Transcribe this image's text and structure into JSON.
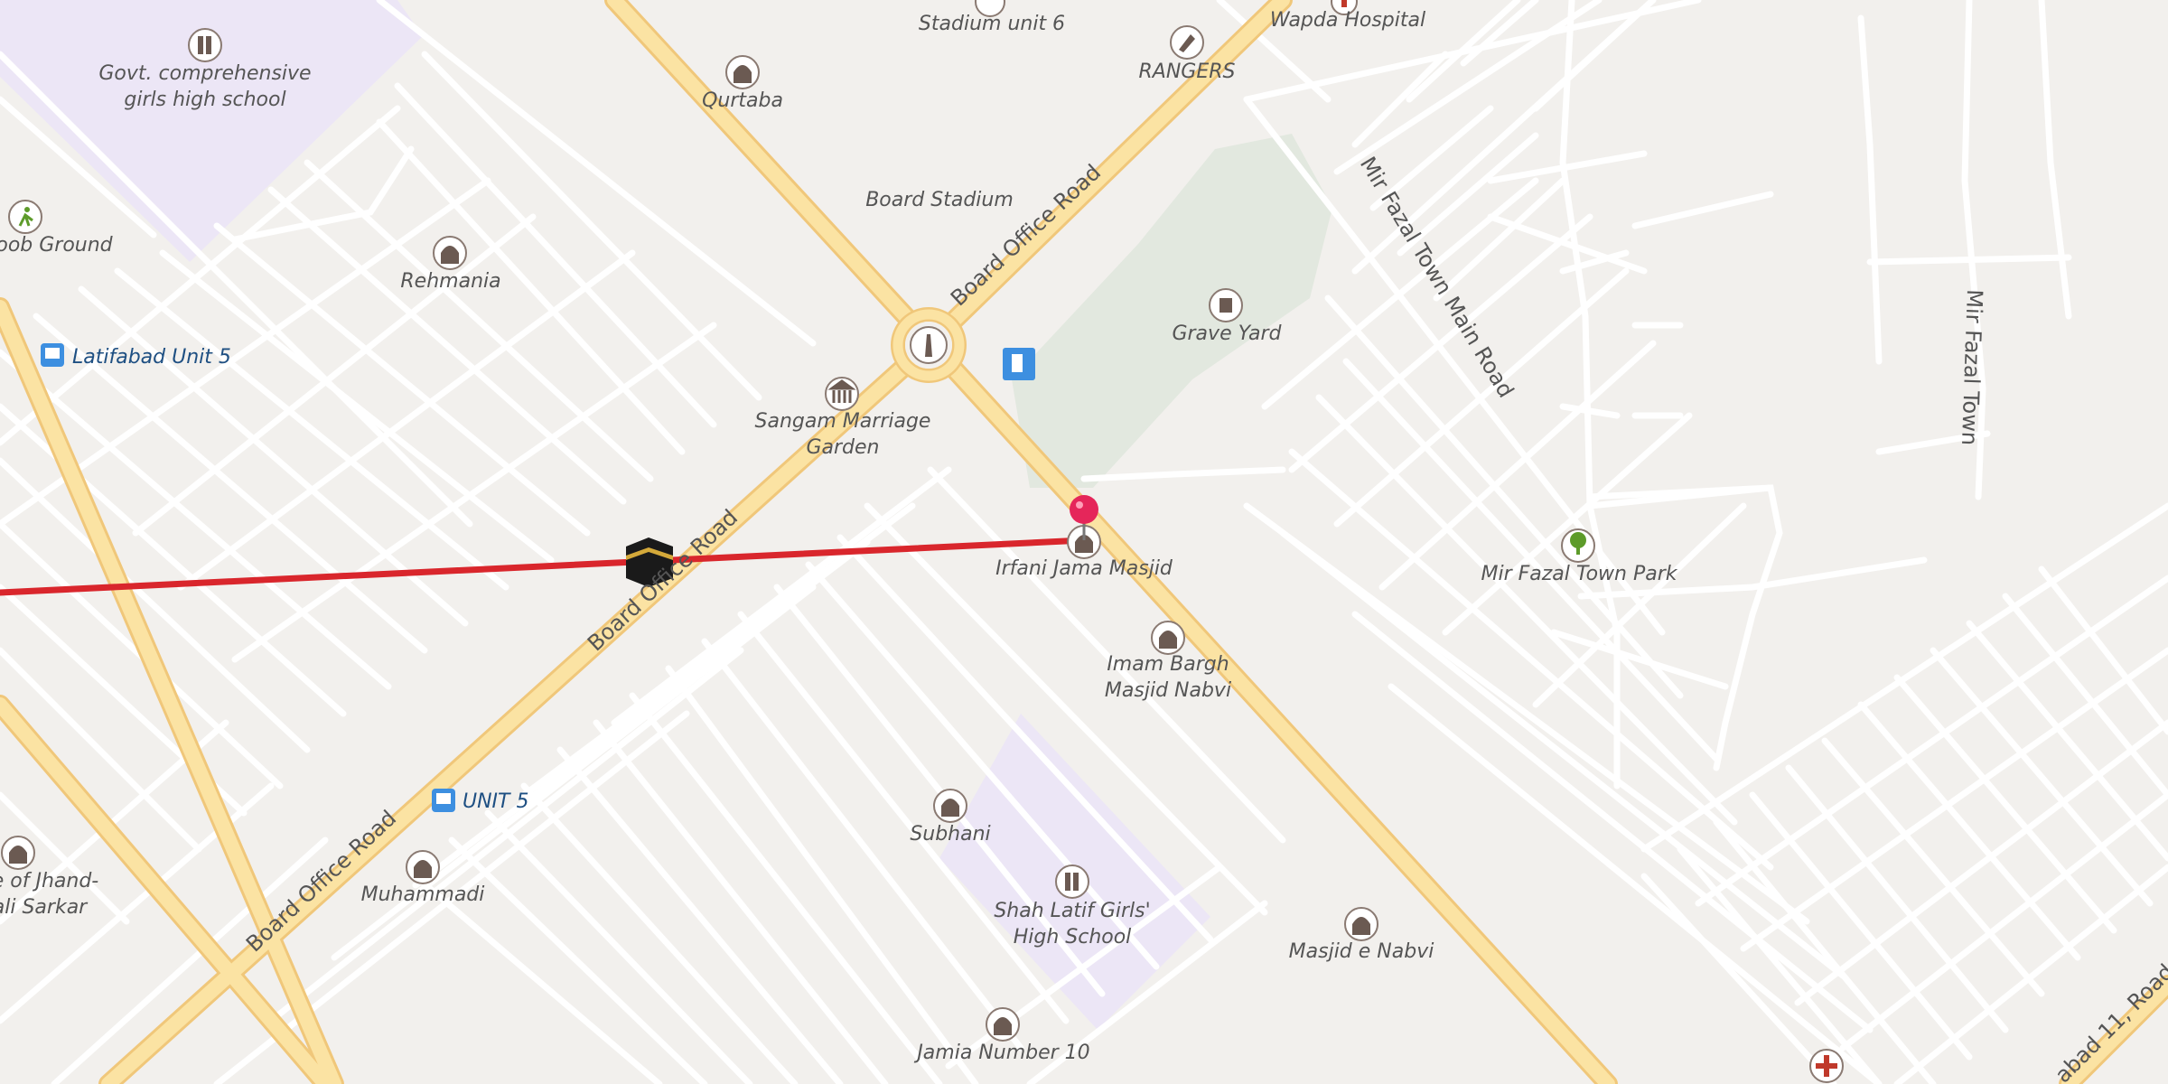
{
  "map": {
    "colors": {
      "background": "#f2f0ed",
      "minor_road": "#ffffff",
      "main_road": "#fbe3a3",
      "main_road_edge": "#f0c77a",
      "school_area": "#ece6f6",
      "graveyard_area": "#e2e8df",
      "route_line": "#d9262c",
      "poi_icon_bg": "#ffffff",
      "poi_icon_fg": "#6b5a52",
      "transit_blue": "#3d8fe0",
      "fuel_blue": "#3d8fe0",
      "hospital_red": "#c0392b",
      "pin_pink": "#e5265a",
      "park_green": "#5d9b2a"
    },
    "pois": [
      {
        "id": "stadium-unit-6",
        "label": "Stadium unit 6",
        "icon": "institution-icon"
      },
      {
        "id": "wapda-hospital",
        "label": "Wapda Hospital",
        "icon": "hospital-icon"
      },
      {
        "id": "govt-school",
        "label": "Govt. comprehensive girls high school",
        "lines": [
          "Govt. comprehensive",
          "girls high school"
        ],
        "icon": "school-icon"
      },
      {
        "id": "qurtaba",
        "label": "Qurtaba",
        "icon": "mosque-icon"
      },
      {
        "id": "rangers",
        "label": "RANGERS",
        "icon": "police-icon"
      },
      {
        "id": "board-stadium",
        "label": "Board Stadium",
        "icon": ""
      },
      {
        "id": "ground",
        "label": "oob Ground",
        "icon": "sports-icon"
      },
      {
        "id": "rehmania",
        "label": "Rehmania",
        "icon": "mosque-icon"
      },
      {
        "id": "grave-yard",
        "label": "Grave Yard",
        "icon": "cemetery-icon"
      },
      {
        "id": "latifabad-unit-5",
        "label": "Latifabad Unit 5",
        "icon": "bus-icon"
      },
      {
        "id": "sangam",
        "label": "Sangam Marriage Garden",
        "lines": [
          "Sangam Marriage",
          "Garden"
        ],
        "icon": "hall-icon"
      },
      {
        "id": "irfani",
        "label": "Irfani Jama Masjid",
        "icon": "mosque-icon"
      },
      {
        "id": "mir-fazal-park",
        "label": "Mir Fazal Town Park",
        "icon": "tree-icon"
      },
      {
        "id": "imam-bargh",
        "label": "Imam Bargh Masjid Nabvi",
        "lines": [
          "Imam Bargh",
          "Masjid Nabvi"
        ],
        "icon": "mosque-icon"
      },
      {
        "id": "unit-5",
        "label": "UNIT 5",
        "icon": "bus-icon"
      },
      {
        "id": "subhani",
        "label": "Subhani",
        "icon": "mosque-icon"
      },
      {
        "id": "jhand",
        "label": "e of Jhand- ali Sarkar",
        "lines": [
          "e of Jhand-",
          "ali Sarkar"
        ],
        "icon": "mosque-icon"
      },
      {
        "id": "muhammadi",
        "label": "Muhammadi",
        "icon": "mosque-icon"
      },
      {
        "id": "shah-latif",
        "label": "Shah Latif Girls' High School",
        "lines": [
          "Shah Latif Girls'",
          "High School"
        ],
        "icon": "school-icon"
      },
      {
        "id": "masjid-e-nabvi",
        "label": "Masjid e Nabvi",
        "icon": "mosque-icon"
      },
      {
        "id": "jamia-10",
        "label": "Jamia Number 10",
        "icon": "mosque-icon"
      },
      {
        "id": "hospital-corner",
        "label": "",
        "icon": "hospital-icon"
      },
      {
        "id": "fuel",
        "label": "",
        "icon": "fuel-icon"
      },
      {
        "id": "monument",
        "label": "",
        "icon": "monument-icon"
      }
    ],
    "roads": {
      "board_office_top": "Board Office Road",
      "board_office_mid": "Board Office Road",
      "board_office_bottom": "Board Office Road",
      "mir_fazal_main": "Mir Fazal Town Main Road",
      "mir_fazal_town": "Mir Fazal Town",
      "latifabad_11": "abad 11, Road"
    },
    "markers": {
      "destination_pin": "selected-location",
      "origin_marker": "kaaba-icon"
    }
  }
}
